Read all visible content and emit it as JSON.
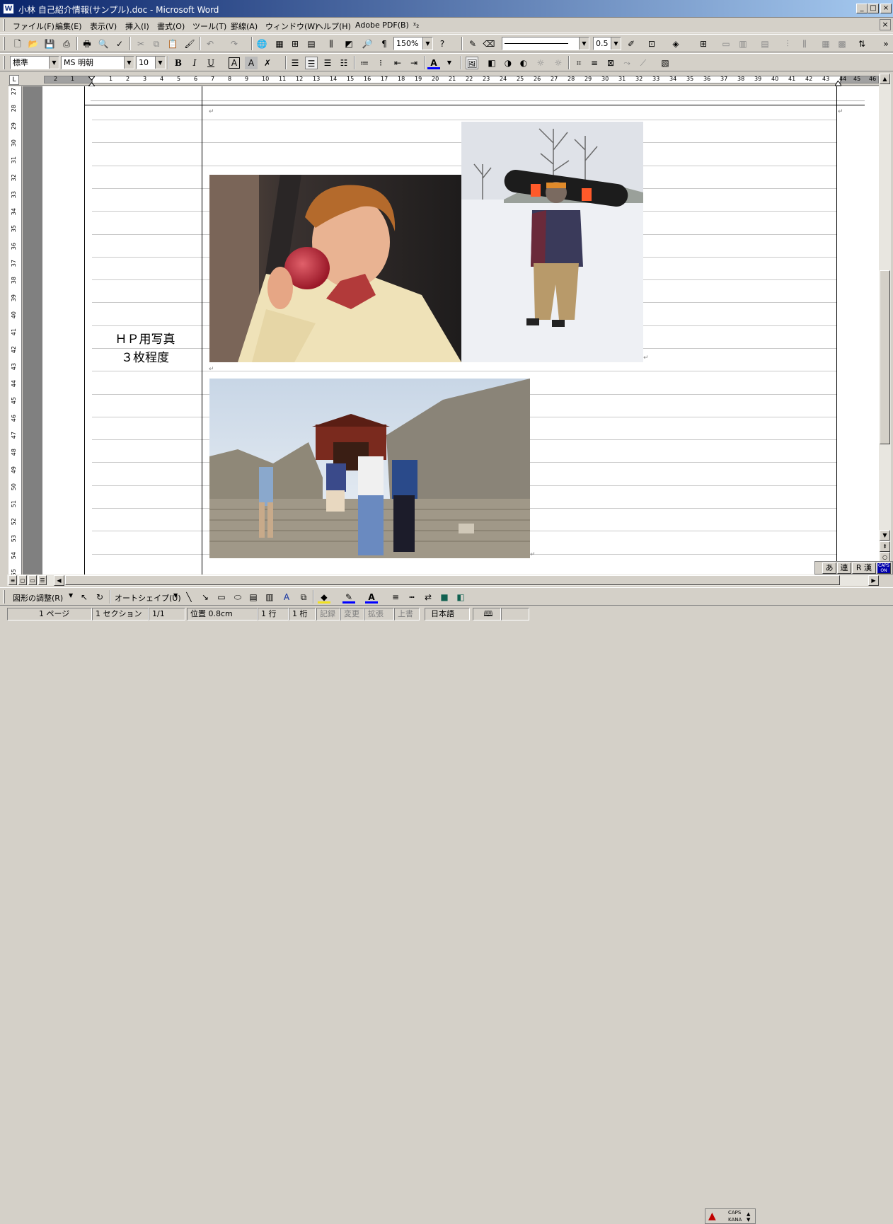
{
  "window": {
    "title": "小林 自己紹介情報(サンプル).doc - Microsoft Word",
    "icon_label": "W",
    "buttons": [
      "_",
      "□",
      "×"
    ]
  },
  "menu": {
    "items": [
      "ファイル(F)",
      "編集(E)",
      "表示(V)",
      "挿入(I)",
      "書式(O)",
      "ツール(T)",
      "罫線(A)",
      "ウィンドウ(W)",
      "ヘルプ(H)",
      "Adobe PDF(B)",
      "ᵡ₂"
    ],
    "doc_close": "×"
  },
  "standard_toolbar": {
    "zoom": "150%",
    "line_weight": "0.5"
  },
  "format_toolbar": {
    "style": "標準",
    "font": "MS 明朝",
    "size": "10",
    "bold": "B",
    "italic": "I",
    "underline": "U",
    "font_color_label": "A"
  },
  "ruler": {
    "tab_selector": "L",
    "h_left_numbers": [
      "2",
      "1"
    ],
    "h_numbers": [
      "1",
      "2",
      "3",
      "4",
      "5",
      "6",
      "7",
      "8",
      "9",
      "10",
      "11",
      "12",
      "13",
      "14",
      "15",
      "16",
      "17",
      "18",
      "19",
      "20",
      "21",
      "22",
      "23",
      "24",
      "25",
      "26",
      "27",
      "28",
      "29",
      "30",
      "31",
      "32",
      "33",
      "34",
      "35",
      "36",
      "37",
      "38",
      "39",
      "40",
      "41",
      "42",
      "43",
      "44"
    ],
    "h_right_numbers": [
      "45",
      "46"
    ],
    "v_numbers": [
      "27",
      "28",
      "29",
      "30",
      "31",
      "32",
      "33",
      "34",
      "35",
      "36",
      "37",
      "38",
      "39",
      "40",
      "41",
      "42",
      "43",
      "44",
      "45",
      "46",
      "47",
      "48",
      "49",
      "50",
      "51",
      "52",
      "53",
      "54",
      "55"
    ]
  },
  "document": {
    "label_line1": "ＨＰ用写真",
    "label_line2": "３枚程度",
    "photos": [
      {
        "name": "apple-photo",
        "description": "Young man biting a red apple, cream sweater"
      },
      {
        "name": "snowboard-photo",
        "description": "Person in snow holding a snowboard over shoulders"
      },
      {
        "name": "castle-photo",
        "description": "Group of kids climbing stone steps at castle gate"
      }
    ]
  },
  "ime_bar": {
    "mode": "あ",
    "conversion": "連",
    "dictionary": "R 漢",
    "status": "CAPS ON"
  },
  "draw_toolbar": {
    "adjust": "図形の調整(R)",
    "autoshape": "オートシェイプ(U)"
  },
  "statusbar": {
    "page": "1 ページ",
    "section": "1 セクション",
    "page_of": "1/1",
    "position": "位置 0.8cm",
    "line": "1 行",
    "column": "1 桁",
    "rec": "記録",
    "trk": "変更",
    "ext": "拡張",
    "ovr": "上書",
    "language": "日本語",
    "caps": "CAPS",
    "kana": "KANA"
  }
}
